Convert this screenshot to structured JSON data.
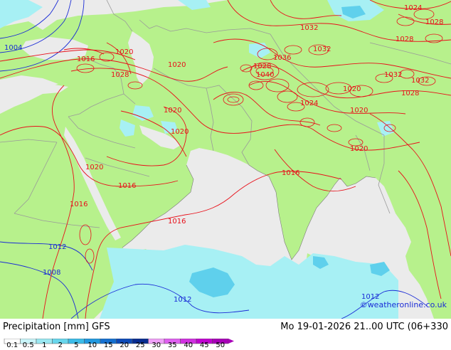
{
  "title": {
    "product": "Precipitation [mm]",
    "model": "GFS",
    "datetime": "Mo 19-01-2026 21..00 UTC (06+330"
  },
  "credit": "©weatheronline.co.uk",
  "colors": {
    "land": "#b7f18c",
    "sea": "#ebebeb",
    "isobar_high": "#e8101a",
    "isobar_low": "#1a2bd6",
    "border": "#9a9a9a",
    "precip_light": "#a7f0f4",
    "precip_medium": "#5fd0ec"
  },
  "legend": {
    "ticks": [
      "0.1",
      "0.5",
      "1",
      "2",
      "5",
      "10",
      "15",
      "20",
      "25",
      "30",
      "35",
      "40",
      "45",
      "50"
    ],
    "colors": [
      "#ffffff",
      "#c9f4f8",
      "#9ae8f2",
      "#68d6ec",
      "#3cbce8",
      "#2199e0",
      "#1570d0",
      "#0d4ab8",
      "#082c90",
      "#f0a0f8",
      "#e060f0",
      "#d030e0",
      "#c000d0",
      "#a800b8"
    ]
  },
  "isobars": [
    {
      "label": "1024",
      "color": "red"
    },
    {
      "label": "1032",
      "color": "red"
    },
    {
      "label": "1028",
      "color": "red"
    },
    {
      "label": "1032",
      "color": "red"
    },
    {
      "label": "1028",
      "color": "red"
    },
    {
      "label": "1032",
      "color": "red"
    },
    {
      "label": "1032",
      "color": "red"
    },
    {
      "label": "1028",
      "color": "red"
    },
    {
      "label": "1016",
      "color": "red"
    },
    {
      "label": "1020",
      "color": "red"
    },
    {
      "label": "1028",
      "color": "red"
    },
    {
      "label": "1020",
      "color": "red"
    },
    {
      "label": "1036",
      "color": "red"
    },
    {
      "label": "1028",
      "color": "red"
    },
    {
      "label": "1040",
      "color": "red"
    },
    {
      "label": "1024",
      "color": "red"
    },
    {
      "label": "1020",
      "color": "red"
    },
    {
      "label": "1020",
      "color": "red"
    },
    {
      "label": "1020",
      "color": "red"
    },
    {
      "label": "1020",
      "color": "red"
    },
    {
      "label": "1020",
      "color": "red"
    },
    {
      "label": "1016",
      "color": "red"
    },
    {
      "label": "1020",
      "color": "red"
    },
    {
      "label": "1016",
      "color": "red"
    },
    {
      "label": "1016",
      "color": "red"
    },
    {
      "label": "1016",
      "color": "red"
    },
    {
      "label": "1004",
      "color": "blue"
    },
    {
      "label": "1012",
      "color": "blue"
    },
    {
      "label": "1008",
      "color": "blue"
    },
    {
      "label": "1012",
      "color": "blue"
    },
    {
      "label": "1012",
      "color": "blue"
    }
  ]
}
